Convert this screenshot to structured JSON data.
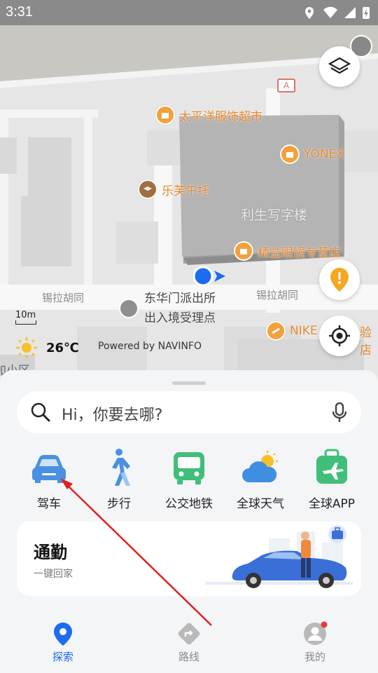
{
  "status_bar": {
    "time": "3:31"
  },
  "map": {
    "pois": [
      {
        "name": "太平洋服饰超市"
      },
      {
        "name": "YONEX"
      },
      {
        "name": "乐芙午托"
      },
      {
        "name": "利生写字楼"
      },
      {
        "name": "精益眼镜专营店"
      },
      {
        "name": "东华门派出所"
      },
      {
        "name": "出入境受理点"
      },
      {
        "name": "NIKE"
      },
      {
        "name": "验店"
      }
    ],
    "streets": [
      "锡拉胡同",
      "锡拉胡同"
    ],
    "scale": "10m",
    "temperature": "26℃",
    "credit": "Powered by NAVINFO",
    "road_badge": "A",
    "district_fragment": "加小区"
  },
  "search": {
    "placeholder": "Hi，你要去哪?"
  },
  "quick_actions": [
    {
      "label": "驾车",
      "icon": "car-icon"
    },
    {
      "label": "步行",
      "icon": "walk-icon"
    },
    {
      "label": "公交地铁",
      "icon": "bus-icon"
    },
    {
      "label": "全球天气",
      "icon": "weather-icon"
    },
    {
      "label": "全球APP",
      "icon": "travel-icon"
    }
  ],
  "commute": {
    "title": "通勤",
    "subtitle": "一键回家"
  },
  "bottom_nav": [
    {
      "label": "探索",
      "active": true
    },
    {
      "label": "路线",
      "active": false
    },
    {
      "label": "我的",
      "active": false
    }
  ],
  "colors": {
    "accent": "#1a6cf0",
    "poi_orange": "#f2a23a",
    "annotation_arrow": "#e02020"
  }
}
